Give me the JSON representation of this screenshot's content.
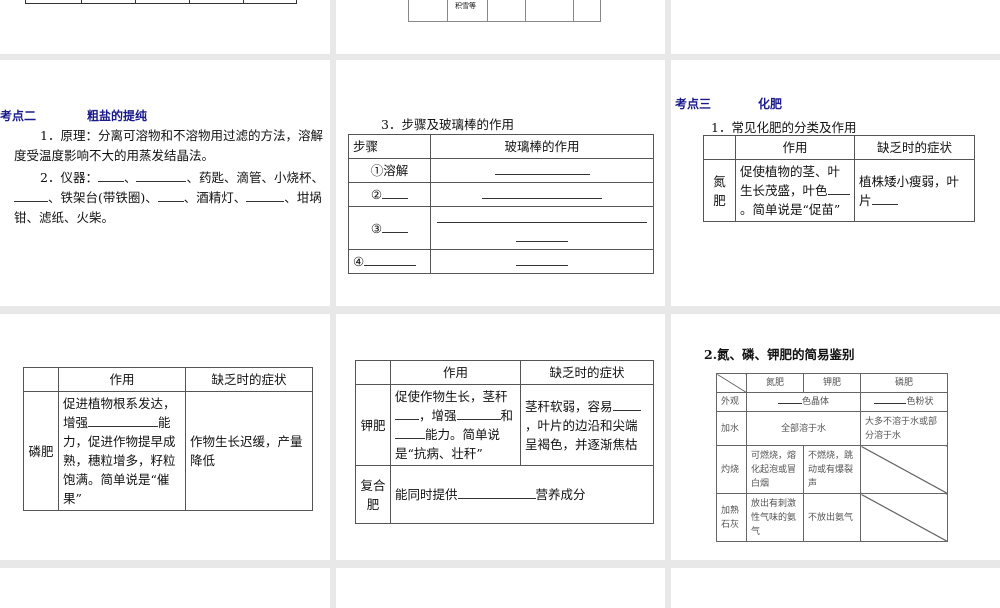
{
  "slides": {
    "s2": {
      "frag_text": "积雪等"
    },
    "s4": {
      "kaodian": "考点二",
      "title": "粗盐的提纯",
      "p1": "1．原理：分离可溶物和不溶物用过滤的方法，溶解度受温度影响不大的用蒸发结晶法。",
      "p2a": "2．仪器：",
      "p2b": "、",
      "p2c": "、药匙、滴管、小烧杯、",
      "p2d": "、铁架台(带铁圈)、",
      "p2e": "、酒精灯、",
      "p2f": "、坩埚钳、滤纸、火柴。"
    },
    "s5": {
      "title": "3．步骤及玻璃棒的作用",
      "h1": "步骤",
      "h2": "玻璃棒的作用",
      "r1": "①溶解",
      "r2": "②",
      "r3": "③",
      "r4": "④"
    },
    "s6": {
      "kaodian": "考点三",
      "title": "化肥",
      "subtitle": "1．常见化肥的分类及作用",
      "h1": "作用",
      "h2": "缺乏时的症状",
      "row": "氮肥",
      "effect_a": "促使植物的茎、叶生长茂盛，叶色",
      "effect_b": "。简单说是“促苗”",
      "symptom": "植株矮小瘦弱，叶片"
    },
    "s7": {
      "h1": "作用",
      "h2": "缺乏时的症状",
      "row": "磷肥",
      "effect_a": "促进植物根系发达，增强",
      "effect_b": "能力，促进作物提早成熟，穗粒增多，籽粒饱满。简单说是“催果”",
      "symptom": "作物生长迟缓，产量降低"
    },
    "s8": {
      "h1": "作用",
      "h2": "缺乏时的症状",
      "row1": "钾肥",
      "effect_a": "促使作物生长，茎秆",
      "effect_b": "，增强",
      "effect_c": "和",
      "effect_d": "能力。简单说是“抗病、壮秆”",
      "symptom_a": "茎秆软弱，容易",
      "symptom_b": "，叶片的边沿和尖端呈褐色，并逐渐焦枯",
      "row2": "复合肥",
      "compound_a": "能同时提供",
      "compound_b": "营养成分"
    },
    "s9": {
      "title": "2.氮、磷、钾肥的简易鉴别",
      "cols": [
        "氮肥",
        "钾肥",
        "磷肥"
      ],
      "r_look": "外观",
      "look_a": "色晶体",
      "look_b": "色粉状",
      "r_water": "加水",
      "water_a": "全部溶于水",
      "water_b": "大多不溶于水或部分溶于水",
      "r_burn": "灼烧",
      "burn_n": "可燃烧，熔化起泡或冒白烟",
      "burn_k": "不燃烧，跳动或有爆裂声",
      "r_lime": "加熟石灰",
      "lime_n": "放出有刺激性气味的氨气",
      "lime_k": "不放出氨气"
    }
  }
}
